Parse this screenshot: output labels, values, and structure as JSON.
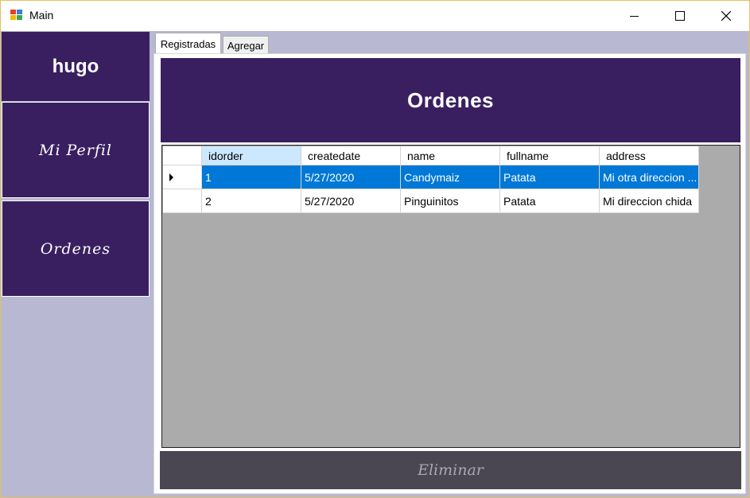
{
  "window": {
    "title": "Main"
  },
  "sidebar": {
    "user_name": "hugo",
    "items": [
      {
        "label": "Mi Perfil"
      },
      {
        "label": "Ordenes"
      }
    ]
  },
  "tabs": [
    {
      "label": "Registradas",
      "active": true
    },
    {
      "label": "Agregar",
      "active": false
    }
  ],
  "main": {
    "header_title": "Ordenes",
    "grid": {
      "columns": [
        "idorder",
        "createdate",
        "name",
        "fullname",
        "address"
      ],
      "rows": [
        [
          "1",
          "5/27/2020",
          "Candymaiz",
          "Patata",
          "Mi otra direccion ..."
        ],
        [
          "2",
          "5/27/2020",
          "Pinguinitos",
          "Patata",
          "Mi direccion chida"
        ]
      ],
      "selected_row": 0
    },
    "delete_button": "Eliminar"
  },
  "colors": {
    "purple": "#3a1f60",
    "lavender": "#b8b8d2",
    "selection": "#0078d7",
    "grid_background": "#ababab",
    "button_dark": "#4a4652"
  },
  "icons": {
    "app": "app-window-icon",
    "minimize": "minimize-icon",
    "maximize": "maximize-icon",
    "close": "close-icon",
    "row_pointer": "row-pointer-icon"
  }
}
